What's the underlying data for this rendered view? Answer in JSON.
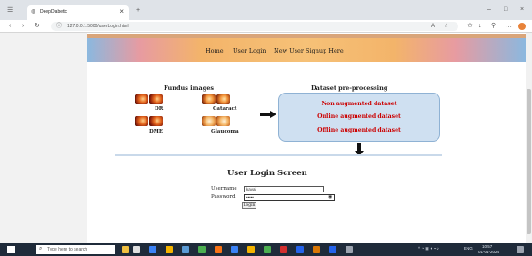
{
  "browser": {
    "tab_title": "DeepDiabetic",
    "url": "127.0.0.1:5000/userLogin.html",
    "tab_close": "×",
    "window_minimize": "–",
    "window_maximize": "□",
    "window_close": "×"
  },
  "nav": {
    "home": "Home",
    "user_login": "User Login",
    "signup": "New User Signup Here"
  },
  "diagram": {
    "fundus_title": "Fundus images",
    "labels": [
      "DR",
      "Cataract",
      "DME",
      "Glaucoma"
    ],
    "dataset_title": "Dataset pre-processing",
    "dataset_items": [
      "Non augmented dataset",
      "Online augmented dataset",
      "Offline augmented dataset"
    ]
  },
  "login": {
    "heading": "User Login Screen",
    "username_label": "Username",
    "username_value": "kavai",
    "password_label": "Password",
    "password_value": "•••••",
    "button": "Login"
  },
  "taskbar": {
    "search_placeholder": "Type here to search",
    "time": "10:57",
    "date": "01-01-2024",
    "language": "ENG"
  },
  "colors": {
    "accent_red": "#cc0000",
    "box_fill": "#cfe0f1",
    "taskbar": "#1f2b3a"
  }
}
